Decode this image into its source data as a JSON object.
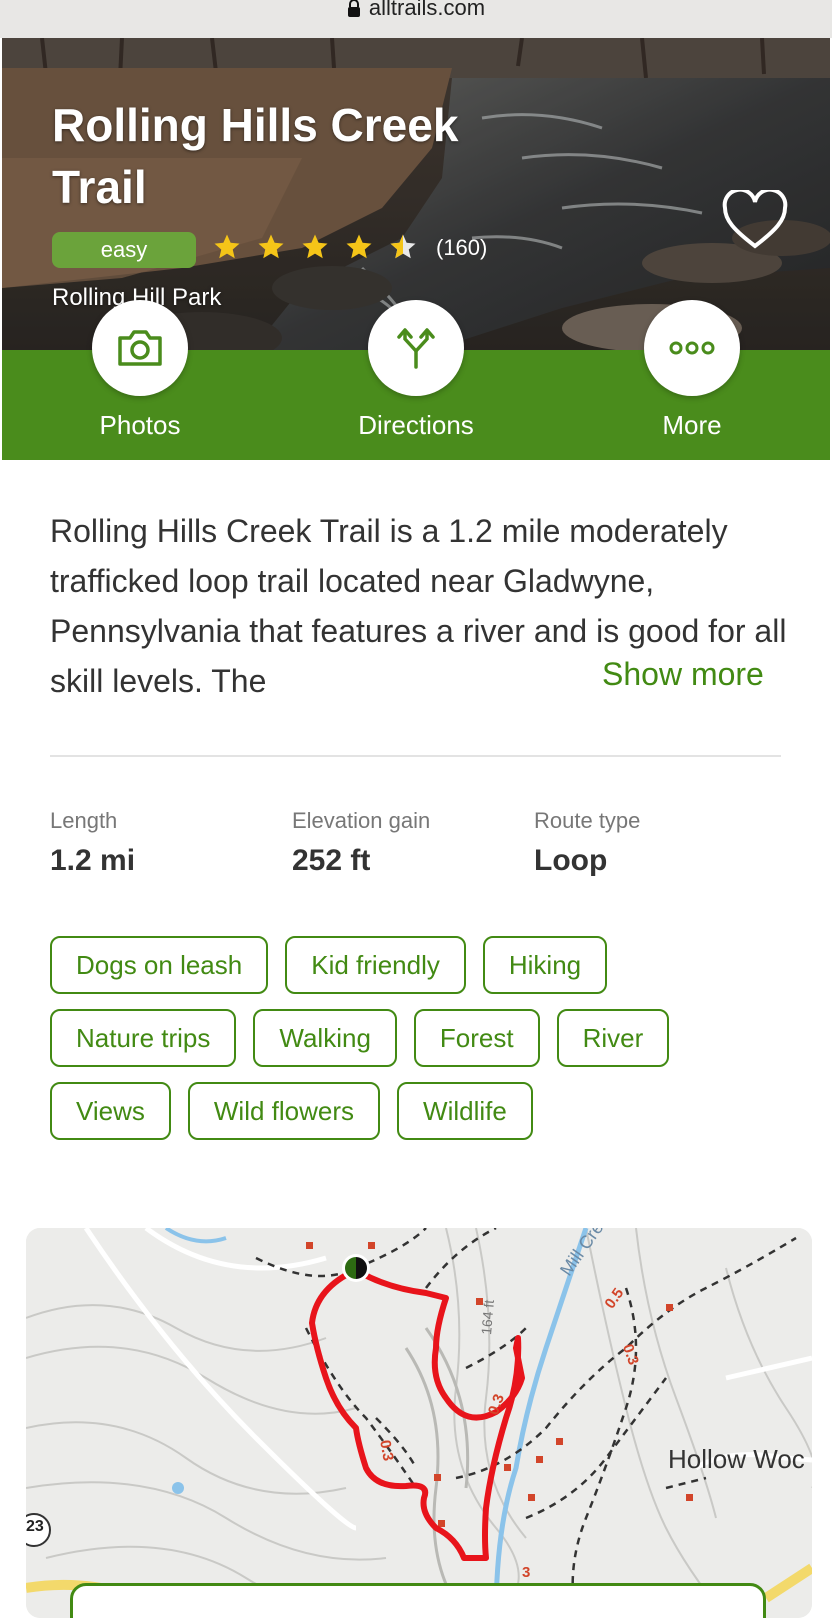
{
  "browser": {
    "url": "alltrails.com",
    "lock_icon": "lock-icon"
  },
  "trail": {
    "title": "Rolling Hills Creek Trail",
    "difficulty": "easy",
    "rating": 4.5,
    "rating_count": "(160)",
    "park": "Rolling Hill Park"
  },
  "actions": [
    {
      "label": "Photos",
      "icon": "camera-icon"
    },
    {
      "label": "Directions",
      "icon": "directions-icon"
    },
    {
      "label": "More",
      "icon": "more-dots-icon"
    }
  ],
  "description": {
    "text": "Rolling Hills Creek Trail is a 1.2 mile moderately trafficked loop trail located near Gladwyne, Pennsylvania that features a river and is good for all skill levels. The",
    "show_more": "Show more"
  },
  "stats": {
    "length": {
      "label": "Length",
      "value": "1.2 mi"
    },
    "elevation": {
      "label": "Elevation gain",
      "value": "252 ft"
    },
    "route": {
      "label": "Route type",
      "value": "Loop"
    }
  },
  "tags": [
    [
      "Dogs on leash",
      "Kid friendly",
      "Hiking"
    ],
    [
      "Nature trips",
      "Walking",
      "Forest",
      "River"
    ],
    [
      "Views",
      "Wild flowers",
      "Wildlife"
    ]
  ],
  "map": {
    "place_label": "Hollow Woc",
    "creek_label": "Mill Cree",
    "contour_label": "164 ft",
    "mile_markers": [
      "0.5",
      "0.3",
      "0.3",
      "0.3",
      "3"
    ],
    "route_number": "23"
  },
  "colors": {
    "brand_green": "#4a8c1c",
    "text_green": "#428a13",
    "difficulty_green": "#6ba33b",
    "star_yellow": "#f5c518",
    "route_red": "#e8141b"
  }
}
